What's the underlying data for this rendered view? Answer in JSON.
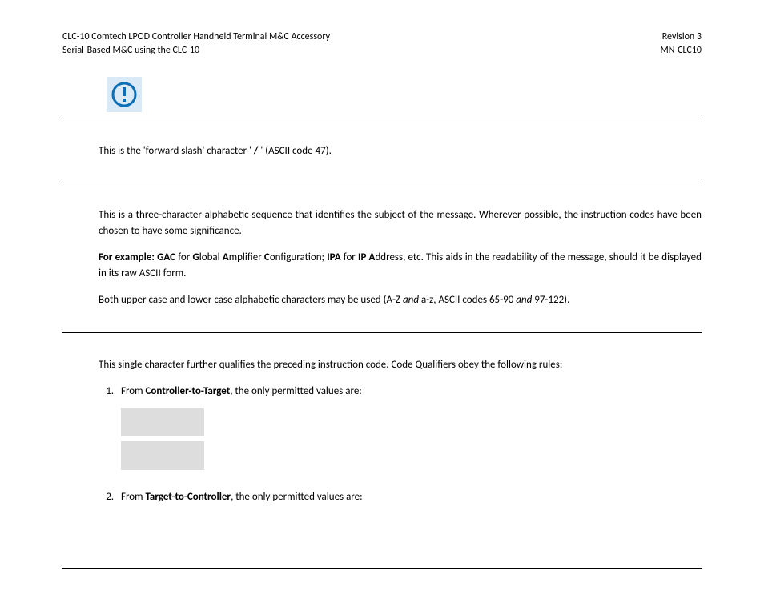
{
  "header": {
    "leftLine1": "CLC-10 Comtech LPOD Controller Handheld Terminal M&C Accessory",
    "leftLine2": "Serial-Based M&C using the CLC-10",
    "rightLine1": "Revision 3",
    "rightLine2": "MN-CLC10"
  },
  "section1": {
    "text_pre": "This is the 'forward slash' character ' ",
    "slash": "/",
    "text_post": " ' (ASCII code 47)."
  },
  "section2": {
    "para1": "This is a three-character alphabetic sequence that identifies the subject of the message. Wherever possible, the instruction codes have been chosen to have some significance.",
    "para2_pre": "For example: GAC",
    "para2_mid1": " for ",
    "para2_g": "G",
    "para2_lobal": "lobal ",
    "para2_a": "A",
    "para2_mplifier": "mplifier ",
    "para2_c": "C",
    "para2_onfig": "onfiguration; ",
    "para2_ipa": "IPA",
    "para2_for2": " for ",
    "para2_ip": "IP A",
    "para2_ddress": "ddress, etc. This aids in the readability of the message, should it be displayed in its raw ASCII form.",
    "para3_pre": "Both upper case and lower case alphabetic characters may be used (A-Z ",
    "para3_and1": "and",
    "para3_mid": " a-z, ASCII codes 65-90 ",
    "para3_and2": "and",
    "para3_post": " 97-122)."
  },
  "section3": {
    "intro": "This single character further qualifies the preceding instruction code. Code Qualifiers obey the following rules:",
    "li1_pre": "From ",
    "li1_bold": "Controller-to-Target",
    "li1_post": ", the only permitted values are:",
    "li2_pre": "From ",
    "li2_bold": "Target-to-Controller",
    "li2_post": ", the only permitted values are:"
  }
}
